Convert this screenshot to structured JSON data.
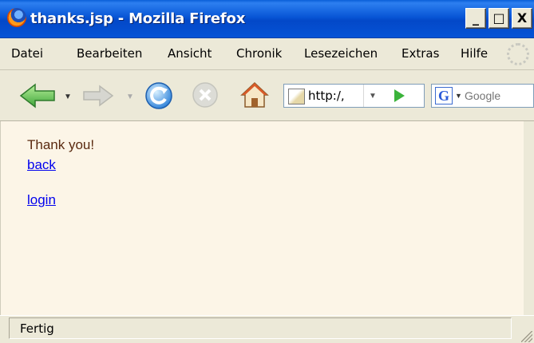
{
  "window": {
    "title": "thanks.jsp - Mozilla Firefox",
    "controls": {
      "minimize": "_",
      "maximize": "□",
      "close": "X"
    }
  },
  "menu": {
    "items": [
      "Datei",
      "Bearbeiten",
      "Ansicht",
      "Chronik",
      "Lesezeichen",
      "Extras",
      "Hilfe"
    ]
  },
  "toolbar": {
    "url": "http:/,",
    "search_placeholder": "Google",
    "icons": [
      "back-icon",
      "forward-icon",
      "reload-icon",
      "stop-icon",
      "home-icon",
      "go-icon",
      "google-icon"
    ]
  },
  "page": {
    "message": "Thank you!",
    "links": {
      "back": "back",
      "login": "login"
    }
  },
  "status": {
    "text": "Fertig"
  },
  "colors": {
    "titlebar": "#0553d6",
    "link": "#0000ee",
    "page_bg": "#fcf5e7",
    "message": "#5a2a10"
  }
}
